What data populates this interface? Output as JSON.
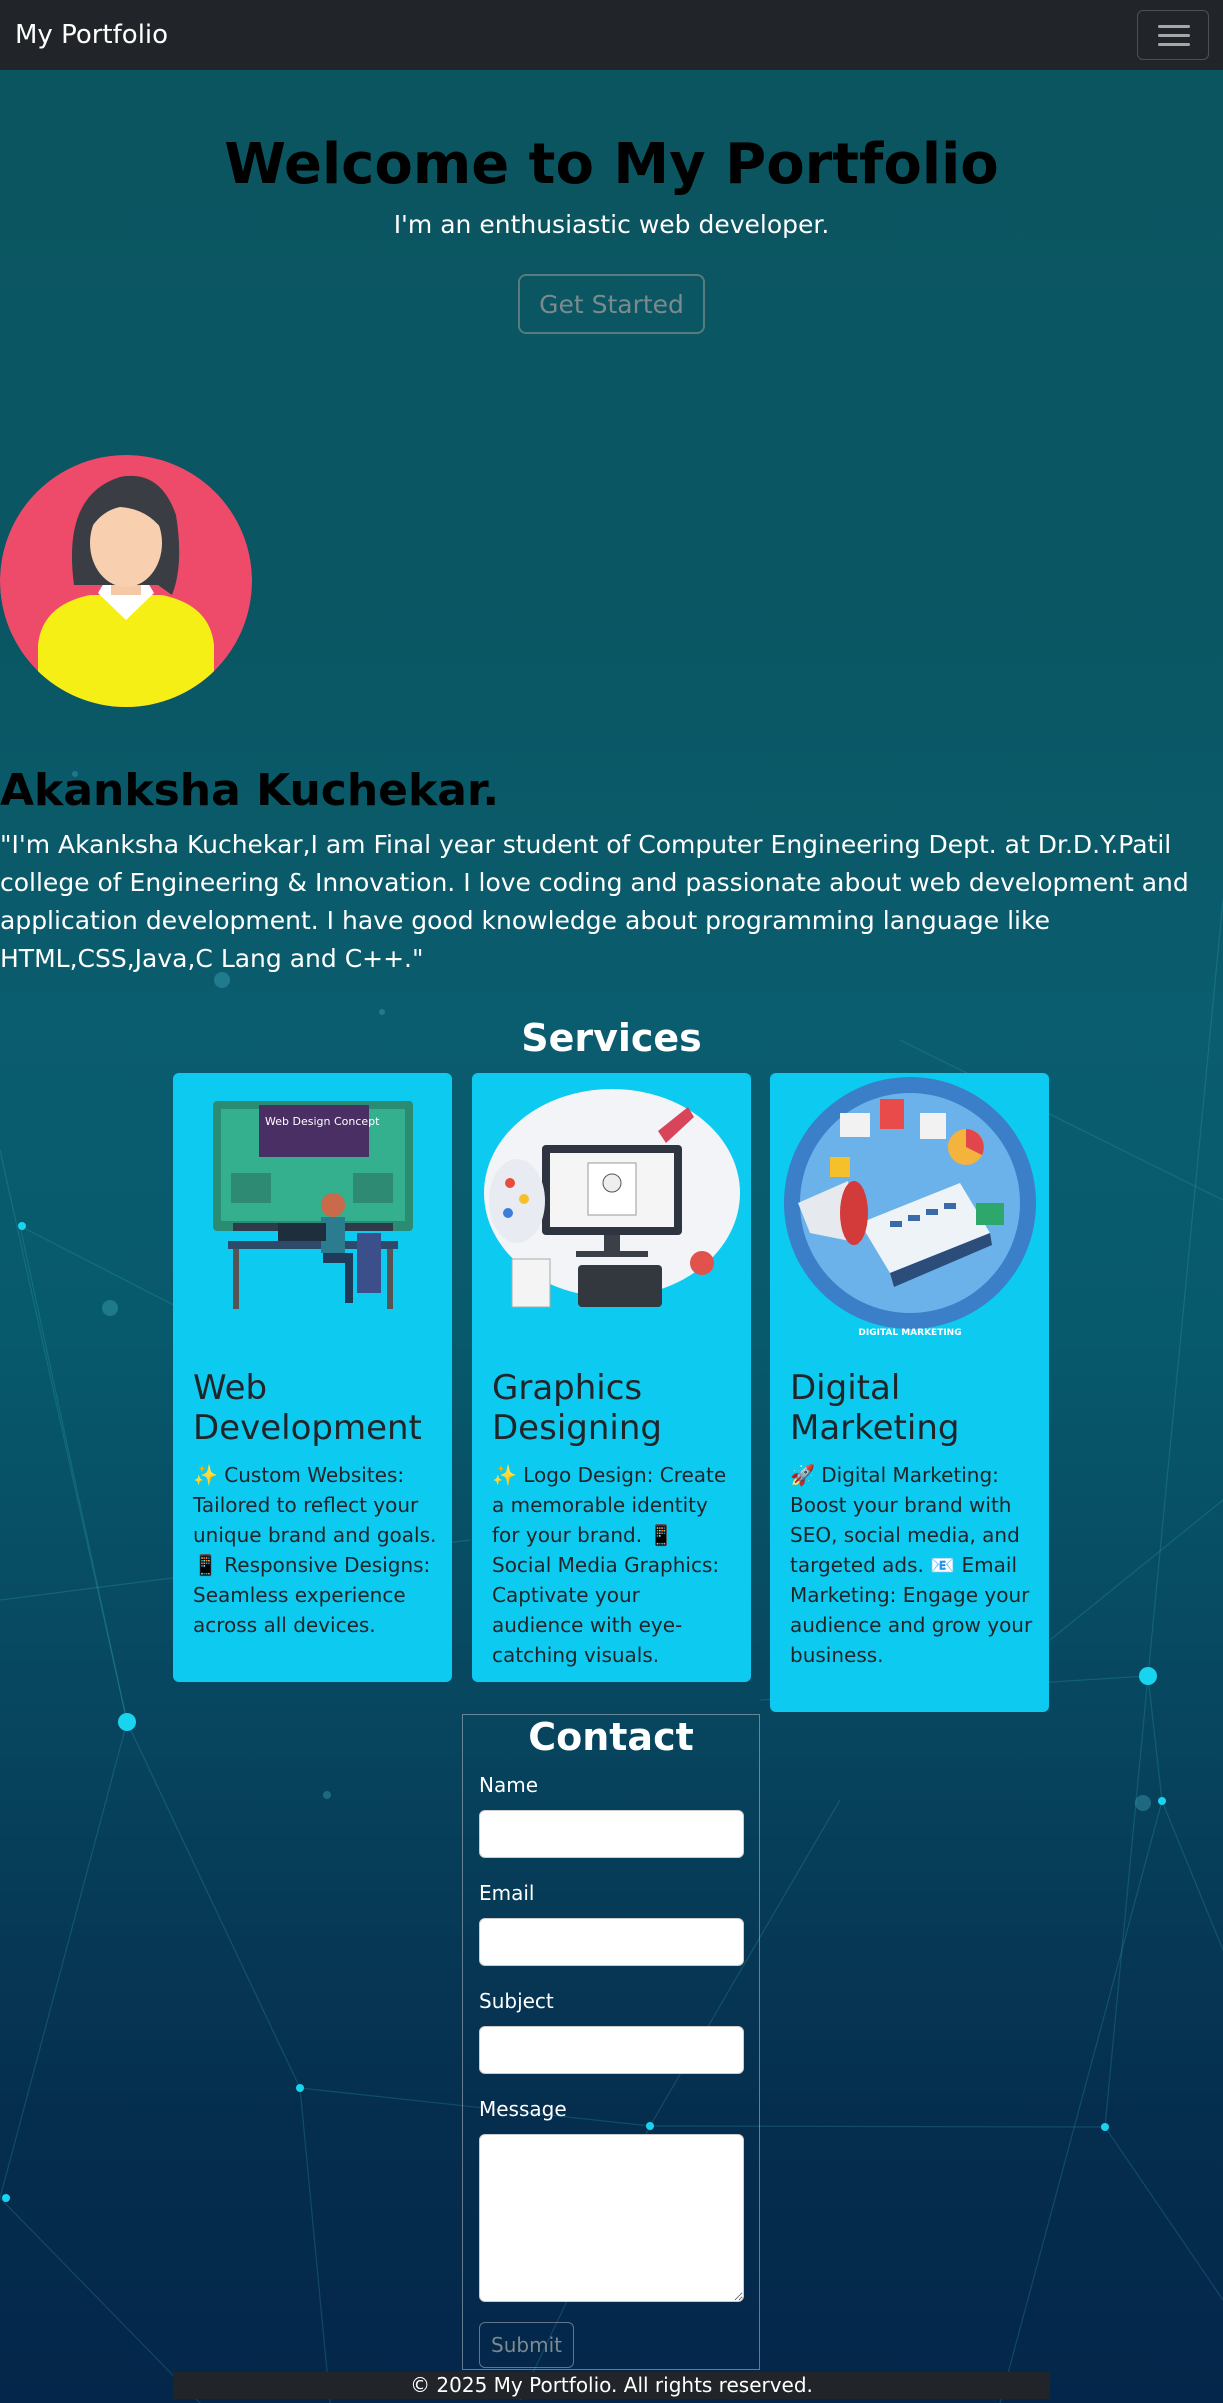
{
  "navbar": {
    "brand": "My Portfolio",
    "toggle_icon": "hamburger-icon"
  },
  "hero": {
    "title": "Welcome to My Portfolio",
    "subtitle": "I'm an enthusiastic web developer.",
    "cta_label": "Get Started"
  },
  "about": {
    "name": "Akanksha Kuchekar.",
    "bio": "\"I'm Akanksha Kuchekar,I am Final year student of Computer Engineering Dept. at Dr.D.Y.Patil college of Engineering & Innovation. I love coding and passionate about web development and application development. I have good knowledge about programming language like HTML,CSS,Java,C Lang and C++.\""
  },
  "services": {
    "title": "Services",
    "cards": [
      {
        "title": "Web Development",
        "image_text": "Web Design Concept",
        "text": "✨ Custom Websites: Tailored to reflect your unique brand and goals. 📱 Responsive Designs: Seamless experience across all devices."
      },
      {
        "title": "Graphics Designing",
        "text": "✨ Logo Design: Create a memorable identity for your brand. 📱 Social Media Graphics: Captivate your audience with eye-catching visuals."
      },
      {
        "title": "Digital Marketing",
        "image_text": "DIGITAL MARKETING",
        "text": "🚀 Digital Marketing: Boost your brand with SEO, social media, and targeted ads. 📧 Email Marketing: Engage your audience and grow your business."
      }
    ]
  },
  "contact": {
    "title": "Contact",
    "fields": {
      "name": "Name",
      "email": "Email",
      "subject": "Subject",
      "message": "Message"
    },
    "values": {
      "name": "",
      "email": "",
      "subject": "",
      "message": ""
    },
    "submit_label": "Submit"
  },
  "footer": {
    "text": "© 2025 My Portfolio. All rights reserved."
  },
  "colors": {
    "navbar": "#212529",
    "card": "#0dcaf0",
    "accent_dots": "#19d4ee"
  }
}
